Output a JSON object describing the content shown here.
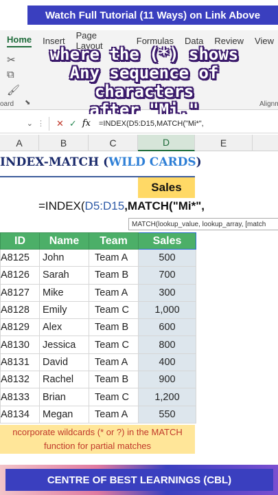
{
  "banner": {
    "top": "Watch Full Tutorial (11 Ways) on Link Above",
    "bottom": "CENTRE OF BEST LEARNINGS (CBL)"
  },
  "ribbon": {
    "tabs": [
      "Home",
      "Insert",
      "Page Layout",
      "Formulas",
      "Data",
      "Review",
      "View"
    ],
    "clipboard_label": "oard",
    "alignment_label": "Alignm"
  },
  "overlay": {
    "line1": "where the (*) shows",
    "line2": "Any sequence of characters",
    "line3": "after \"Mi.\""
  },
  "formula_bar": {
    "formula": "=INDEX(D5:D15,MATCH(\"Mi*\","
  },
  "columns": [
    "A",
    "B",
    "C",
    "D",
    "E"
  ],
  "sheet": {
    "title_part1": "INDEX-MATCH (",
    "title_part2": "WILD CARDS",
    "title_part3": ")",
    "sales_header": "Sales",
    "formula_prefix": "=INDEX(",
    "formula_ref": "D5:D15",
    "formula_match": ",MATCH(",
    "formula_arg": "\"Mi*\",",
    "tooltip": "MATCH(lookup_value, lookup_array, [match",
    "headers": [
      "ID",
      "Name",
      "Team",
      "Sales"
    ],
    "rows": [
      [
        "A8125",
        "John",
        "Team A",
        "500"
      ],
      [
        "A8126",
        "Sarah",
        "Team B",
        "700"
      ],
      [
        "A8127",
        "Mike",
        "Team A",
        "300"
      ],
      [
        "A8128",
        "Emily",
        "Team C",
        "1,000"
      ],
      [
        "A8129",
        "Alex",
        "Team B",
        "600"
      ],
      [
        "A8130",
        "Jessica",
        "Team C",
        "800"
      ],
      [
        "A8131",
        "David",
        "Team A",
        "400"
      ],
      [
        "A8132",
        "Rachel",
        "Team B",
        "900"
      ],
      [
        "A8133",
        "Brian",
        "Team C",
        "1,200"
      ],
      [
        "A8134",
        "Megan",
        "Team A",
        "550"
      ]
    ],
    "note_line1": "ncorporate wildcards (* or ?) in the MATCH",
    "note_line2": "function for partial matches"
  }
}
